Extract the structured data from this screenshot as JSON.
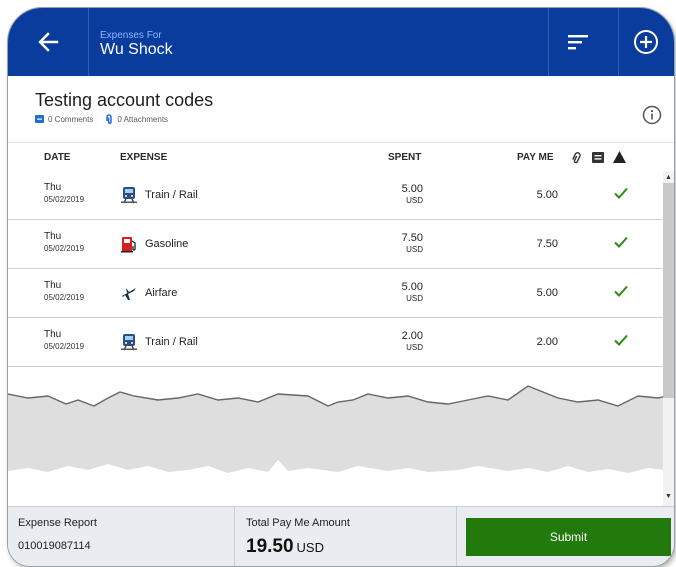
{
  "header": {
    "subtitle": "Expenses For",
    "title": "Wu Shock",
    "back_icon": "arrow-left-icon",
    "sort_icon": "sort-icon",
    "add_icon": "plus-circle-icon",
    "bg_color": "#0a3c9e"
  },
  "report": {
    "title": "Testing account codes",
    "comments": "0 Comments",
    "attachments": "0 Attachments",
    "info_icon": "info-icon"
  },
  "table": {
    "columns": {
      "date": "DATE",
      "expense": "EXPENSE",
      "spent": "SPENT",
      "pay_me": "PAY ME"
    },
    "header_icons": [
      "paperclip-icon",
      "comment-icon",
      "warning-icon"
    ],
    "rows": [
      {
        "day": "Thu",
        "date": "05/02/2019",
        "icon": "train-icon",
        "expense": "Train / Rail",
        "spent": "5.00",
        "currency": "USD",
        "pay_me": "5.00",
        "status_icon": "check-icon"
      },
      {
        "day": "Thu",
        "date": "05/02/2019",
        "icon": "gas-pump-icon",
        "expense": "Gasoline",
        "spent": "7.50",
        "currency": "USD",
        "pay_me": "7.50",
        "status_icon": "check-icon"
      },
      {
        "day": "Thu",
        "date": "05/02/2019",
        "icon": "airplane-icon",
        "expense": "Airfare",
        "spent": "5.00",
        "currency": "USD",
        "pay_me": "5.00",
        "status_icon": "check-icon"
      },
      {
        "day": "Thu",
        "date": "05/02/2019",
        "icon": "train-icon",
        "expense": "Train / Rail",
        "spent": "2.00",
        "currency": "USD",
        "pay_me": "2.00",
        "status_icon": "check-icon"
      }
    ]
  },
  "footer": {
    "report_label": "Expense Report",
    "report_number": "010019087114",
    "total_label": "Total Pay Me Amount",
    "total_value": "19.50",
    "total_currency": "USD",
    "submit_label": "Submit",
    "submit_color": "#217a0b"
  }
}
